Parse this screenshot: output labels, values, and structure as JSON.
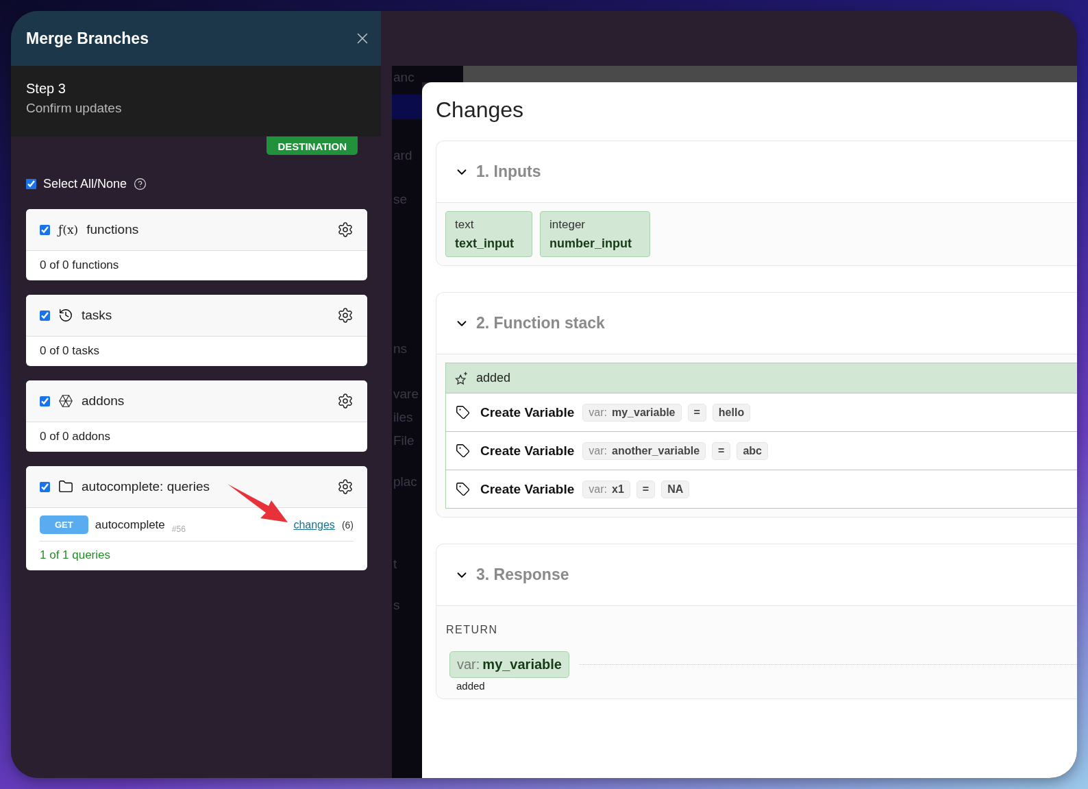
{
  "window": {
    "title": "Merge Branches"
  },
  "step": {
    "title": "Step 3",
    "subtitle": "Confirm updates"
  },
  "destination_badge": "DESTINATION",
  "select_all": {
    "label": "Select All/None",
    "checked": true
  },
  "groups": [
    {
      "kind": "functions",
      "symbol": "ƒ(x)",
      "name": "functions",
      "checked": true,
      "summary": "0 of 0 functions",
      "highlighted": false
    },
    {
      "kind": "tasks",
      "name": "tasks",
      "checked": true,
      "summary": "0 of 0 tasks",
      "highlighted": false
    },
    {
      "kind": "addons",
      "name": "addons",
      "checked": true,
      "summary": "0 of 0 addons",
      "highlighted": false
    },
    {
      "kind": "folder",
      "name": "autocomplete: queries",
      "checked": true,
      "summary": "1 of 1 queries",
      "highlighted": true,
      "items": [
        {
          "method": "GET",
          "name": "autocomplete",
          "number": "#56",
          "link": "changes",
          "count": "(6)"
        }
      ]
    }
  ],
  "background_menu": [
    "anc",
    "ard",
    "se",
    "ns",
    "vare",
    "iles",
    "File",
    "plac",
    "t",
    "s"
  ],
  "changes": {
    "title": "Changes",
    "sections": [
      {
        "kind": "inputs",
        "title": "1. Inputs",
        "expanded": true,
        "inputs": [
          {
            "type": "text",
            "name": "text_input"
          },
          {
            "type": "integer",
            "name": "number_input"
          }
        ]
      },
      {
        "kind": "stack",
        "title": "2. Function stack",
        "expanded": true,
        "group": {
          "label": "added",
          "steps": [
            {
              "label": "Create Variable",
              "prefix": "var:",
              "var": "my_variable",
              "operator": "=",
              "value": "hello"
            },
            {
              "label": "Create Variable",
              "prefix": "var:",
              "var": "another_variable",
              "operator": "=",
              "value": "abc"
            },
            {
              "label": "Create Variable",
              "prefix": "var:",
              "var": "x1",
              "operator": "=",
              "value": "NA"
            }
          ]
        }
      },
      {
        "kind": "response",
        "title": "3. Response",
        "expanded": true,
        "label": "RETURN",
        "value": {
          "prefix": "var:",
          "name": "my_variable",
          "status": "added"
        }
      }
    ]
  }
}
